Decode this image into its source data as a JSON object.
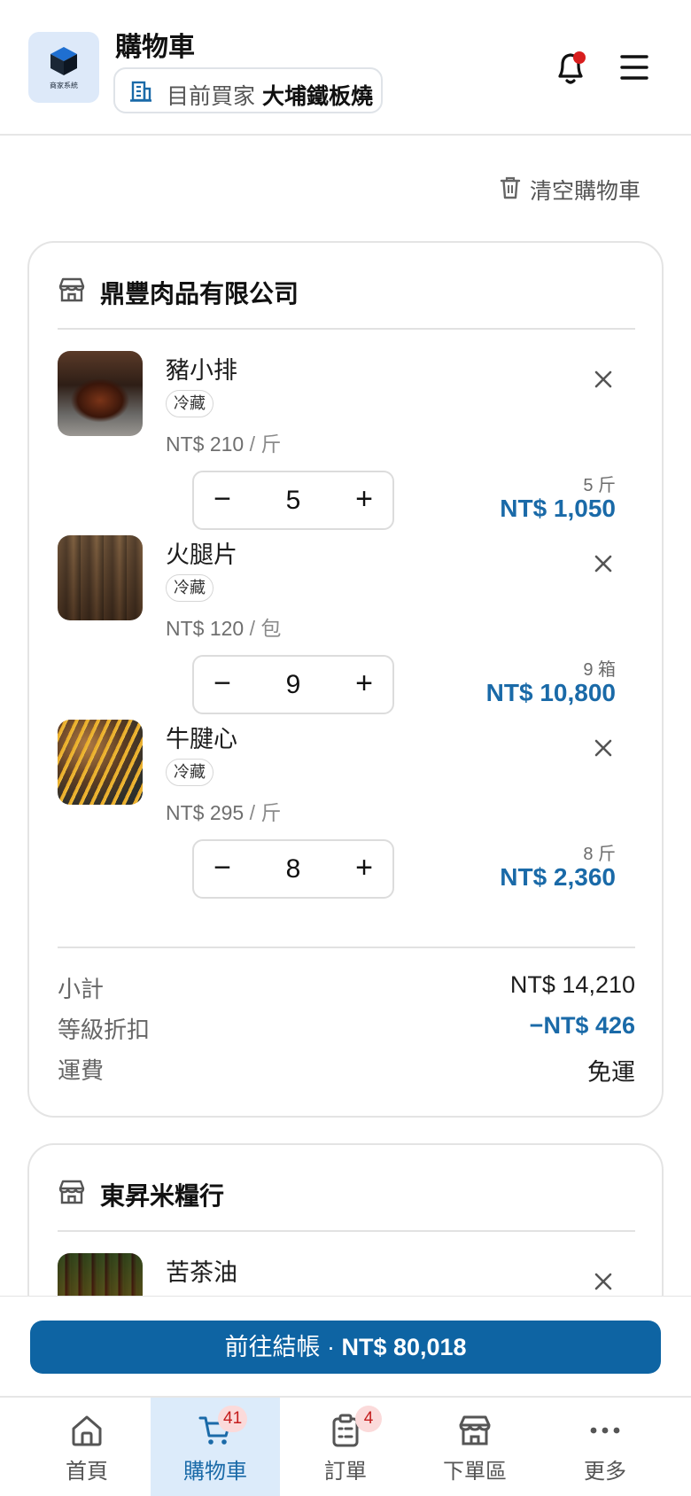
{
  "header": {
    "logo_text": "商家系統",
    "title": "購物車",
    "buyer_label": "目前買家",
    "buyer_name": "大埔鐵板燒"
  },
  "actions": {
    "clear_cart": "清空購物車"
  },
  "vendors": [
    {
      "name": "鼎豐肉品有限公司",
      "items": [
        {
          "name": "豬小排",
          "tag": "冷藏",
          "price": "NT$ 210",
          "unit": "/ 斤",
          "qty": "5",
          "qty_unit": "5 斤",
          "total": "NT$ 1,050"
        },
        {
          "name": "火腿片",
          "tag": "冷藏",
          "price": "NT$ 120",
          "unit": "/ 包",
          "qty": "9",
          "qty_unit": "9 箱",
          "total": "NT$ 10,800"
        },
        {
          "name": "牛腱心",
          "tag": "冷藏",
          "price": "NT$ 295",
          "unit": "/ 斤",
          "qty": "8",
          "qty_unit": "8 斤",
          "total": "NT$ 2,360"
        }
      ],
      "summary": {
        "subtotal_label": "小計",
        "subtotal": "NT$ 14,210",
        "discount_label": "等級折扣",
        "discount": "−NT$ 426",
        "shipping_label": "運費",
        "shipping": "免運"
      }
    },
    {
      "name": "東昇米糧行",
      "items": [
        {
          "name": "苦茶油"
        }
      ]
    }
  ],
  "stepper": {
    "minus": "−",
    "plus": "+"
  },
  "checkout": {
    "label": "前往結帳 · ",
    "amount": "NT$ 80,018"
  },
  "nav": [
    {
      "label": "首頁",
      "icon": "home-icon"
    },
    {
      "label": "購物車",
      "icon": "cart-icon",
      "badge": "41",
      "active": true
    },
    {
      "label": "訂單",
      "icon": "orders-icon",
      "badge": "4"
    },
    {
      "label": "下單區",
      "icon": "store-icon"
    },
    {
      "label": "更多",
      "icon": "more-icon"
    }
  ],
  "colors": {
    "accent": "#0e64a3",
    "price_blue": "#1a6aa8",
    "badge_red": "#c41d1d",
    "notification_dot": "#d81e1e"
  }
}
